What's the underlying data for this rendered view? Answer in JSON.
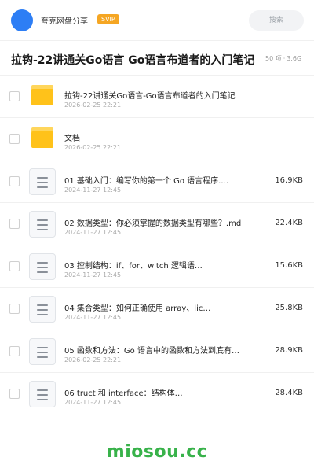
{
  "header": {
    "app_name": "夸克网盘分享",
    "badge": "SVIP",
    "search_label": "搜索",
    "accent_color": "#2d7ef5"
  },
  "share": {
    "title": "拉钩-22讲通关Go语言 Go语言布道者的入门笔记",
    "count": "50 项",
    "total_size": "3.6G"
  },
  "files": [
    {
      "type": "folder",
      "name": "拉钩-22讲通关Go语言-Go语言布道者的入门笔记",
      "date": "2026-02-25 22:21",
      "size": ""
    },
    {
      "type": "folder",
      "name": "文档",
      "date": "2026-02-25 22:21",
      "size": ""
    },
    {
      "type": "doc",
      "name": "01  基础入门：编写你的第一个 Go 语言程序.…",
      "date": "2024-11-27 12:45",
      "size": "16.9KB"
    },
    {
      "type": "doc",
      "name": "02  数据类型：你必须掌握的数据类型有哪些？.md",
      "date": "2024-11-27 12:45",
      "size": "22.4KB"
    },
    {
      "type": "doc",
      "name": "03  控制结构：if、for、witch 逻辑语…",
      "date": "2024-11-27 12:45",
      "size": "15.6KB"
    },
    {
      "type": "doc",
      "name": "04  集合类型：如何正确使用 array、lic…",
      "date": "2024-11-27 12:45",
      "size": "25.8KB"
    },
    {
      "type": "doc",
      "name": "05  函数和方法：Go 语言中的函数和方法到底有…",
      "date": "2026-02-25 22:21",
      "size": "28.9KB"
    },
    {
      "type": "doc",
      "name": "06  truct 和 interface：结构体…",
      "date": "2024-11-27 12:45",
      "size": "28.4KB"
    }
  ],
  "watermark": "miosou.cc"
}
